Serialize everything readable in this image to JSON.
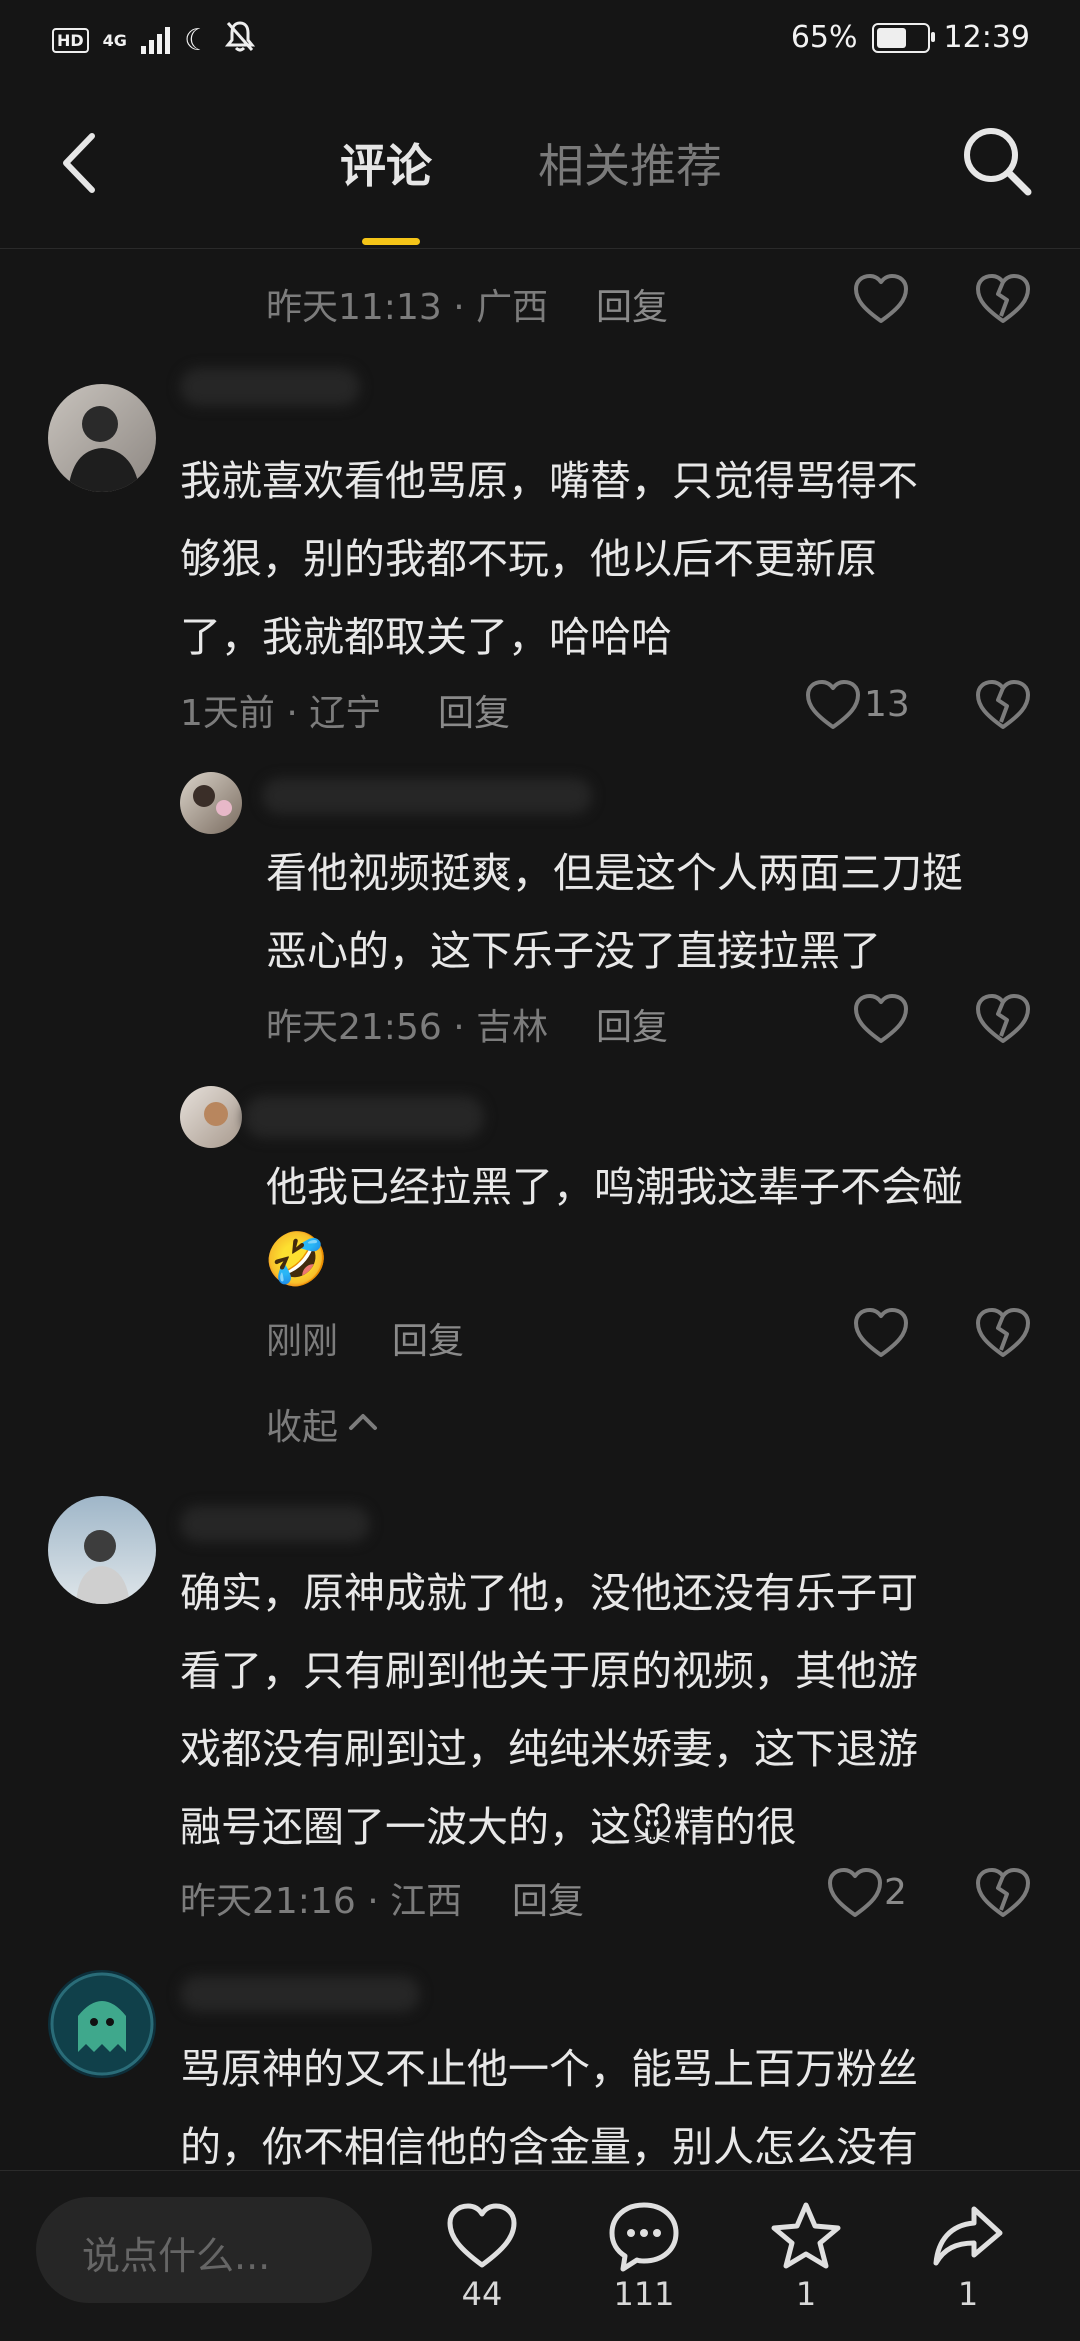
{
  "status": {
    "battery": "65%",
    "time": "12:39",
    "network": "4G",
    "hd": "HD",
    "battery_level": 0.65
  },
  "nav": {
    "tab_active": "评论",
    "tab_other": "相关推荐"
  },
  "comments": [
    {
      "meta": "昨天11:13 · 广西",
      "reply": "回复"
    },
    {
      "text": [
        "我就喜欢看他骂原，嘴替，只觉得骂得不",
        "够狠，别的我都不玩，他以后不更新原",
        "了，我就都取关了，哈哈哈"
      ],
      "meta": "1天前 · 辽宁",
      "reply": "回复",
      "likes": "13"
    },
    {
      "text": [
        "看他视频挺爽，但是这个人两面三刀挺",
        "恶心的，这下乐子没了直接拉黑了"
      ],
      "meta": "昨天21:56 · 吉林",
      "reply": "回复"
    },
    {
      "text": [
        "他我已经拉黑了，鸣潮我这辈子不会碰"
      ],
      "emoji": "🤣",
      "meta": "刚刚",
      "reply": "回复",
      "collapse": "收起"
    },
    {
      "text": [
        "确实，原神成就了他，没他还没有乐子可",
        "看了，只有刷到他关于原的视频，其他游",
        "戏都没有刷到过，纯纯米娇妻，这下退游",
        "融号还圈了一波大的，这",
        "精的很"
      ],
      "emoji": "🐭",
      "meta": "昨天21:16 · 江西",
      "reply": "回复",
      "likes": "2"
    },
    {
      "text": [
        "骂原神的又不止他一个，能骂上百万粉丝",
        "的，你不相信他的含金量，别人怎么没有"
      ]
    }
  ],
  "bottom": {
    "placeholder": "说点什么...",
    "likes": "44",
    "comments": "111",
    "favorites": "1",
    "shares": "1"
  },
  "icons": [
    "back-icon",
    "search-icon",
    "heart-icon",
    "broken-heart-icon",
    "comment-icon",
    "star-icon",
    "share-icon"
  ],
  "colors": {
    "accent": "#f5c518",
    "background": "#151515"
  }
}
